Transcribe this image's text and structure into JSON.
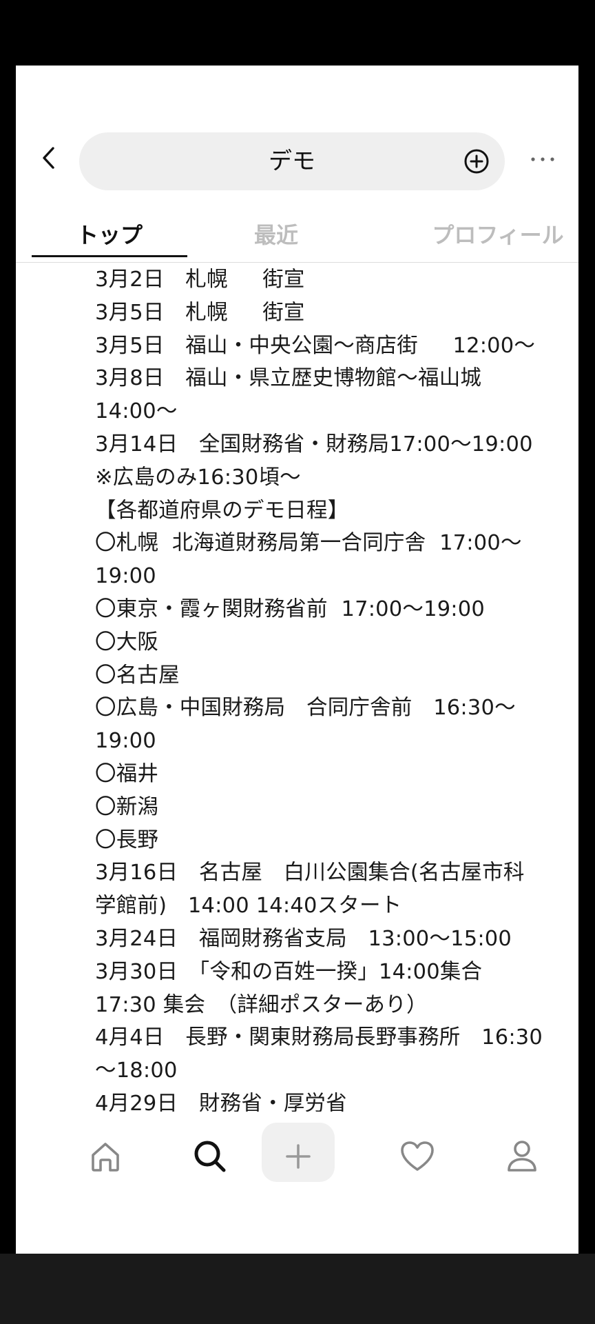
{
  "search": {
    "query": "デモ"
  },
  "tabs": [
    {
      "label": "トップ"
    },
    {
      "label": "最近"
    },
    {
      "label": "プロフィール"
    }
  ],
  "post_lines": [
    "3月2日　札幌　  街宣",
    "3月5日　札幌　  街宣",
    "3月5日　福山・中央公園〜商店街　  12:00〜",
    "3月8日　福山・県立歴史博物館〜福山城",
    "14:00〜",
    "3月14日　全国財務省・財務局17:00〜19:00",
    "※広島のみ16:30頃〜",
    "【各都道府県のデモ日程】",
    "〇札幌  北海道財務局第一合同庁舎  17:00〜",
    "19:00",
    "〇東京・霞ヶ関財務省前  17:00〜19:00",
    "〇大阪",
    "〇名古屋",
    "〇広島・中国財務局　合同庁舎前　16:30〜",
    "19:00",
    "〇福井",
    "〇新潟",
    "〇長野",
    "3月16日　名古屋　白川公園集合(名古屋市科",
    "学館前)　14:00 14:40スタート",
    "3月24日　福岡財務省支局　13:00〜15:00",
    "3月30日　「令和の百姓一揆」14:00集合",
    "17:30 集会　（詳細ポスターあり）",
    "4月4日　長野・関東財務局長野事務所　16:30",
    "〜18:00",
    "4月29日　財務省・厚労省"
  ],
  "icons": {
    "back": "chevron-left-icon",
    "add": "plus-circle-icon",
    "more": "more-horizontal-icon",
    "nav": [
      "home-icon",
      "search-icon",
      "plus-icon",
      "heart-icon",
      "person-icon"
    ]
  },
  "colors": {
    "active": "#111111",
    "inactive": "#bdbdbd",
    "pill": "#efefef"
  }
}
